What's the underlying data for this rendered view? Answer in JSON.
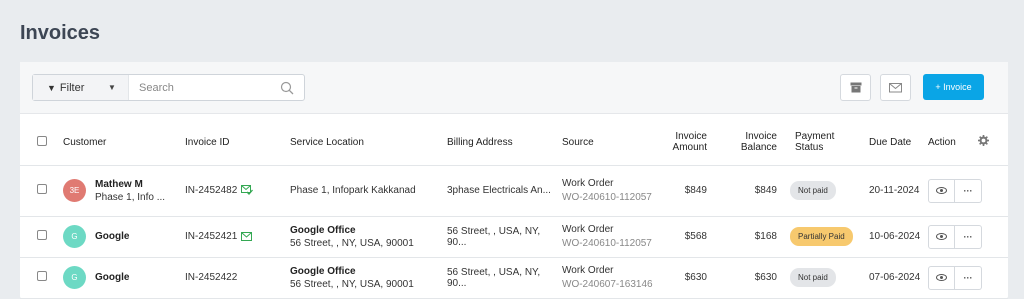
{
  "page": {
    "title": "Invoices"
  },
  "toolbar": {
    "filter_label": "Filter",
    "search_placeholder": "Search",
    "new_invoice_label": "+ Invoice",
    "accent_color": "#0aa5e6"
  },
  "table": {
    "headers": {
      "customer": "Customer",
      "invoice_id": "Invoice ID",
      "service_location": "Service Location",
      "billing_address": "Billing Address",
      "source": "Source",
      "invoice_amount_1": "Invoice",
      "invoice_amount_2": "Amount",
      "invoice_balance_1": "Invoice",
      "invoice_balance_2": "Balance",
      "payment_status": "Payment Status",
      "due_date": "Due Date",
      "action": "Action"
    },
    "rows": [
      {
        "avatar": "3E",
        "avatar_color": "#e07a72",
        "name": "Mathew M",
        "name_sub": "Phase 1, Info ...",
        "invoice_id": "IN-2452482",
        "sent_icon": "mail-check-icon",
        "location_name": "",
        "location_addr": "Phase 1, Infopark Kakkanad",
        "billing": "3phase Electricals An...",
        "source_type": "Work Order",
        "source_id": "WO-240610-112057",
        "amount": "$849",
        "balance": "$849",
        "status": "Not paid",
        "status_color": "#e3e5e8",
        "due": "20-11-2024"
      },
      {
        "avatar": "G",
        "avatar_color": "#6dd9c4",
        "name": "Google",
        "name_sub": "",
        "invoice_id": "IN-2452421",
        "sent_icon": "mail-icon",
        "location_name": "Google Office",
        "location_addr": "56 Street, , NY, USA, 90001",
        "billing": "56 Street, , USA, NY, 90...",
        "source_type": "Work Order",
        "source_id": "WO-240610-112057",
        "amount": "$568",
        "balance": "$168",
        "status": "Partially Paid",
        "status_color": "#f7c96e",
        "due": "10-06-2024"
      },
      {
        "avatar": "G",
        "avatar_color": "#6dd9c4",
        "name": "Google",
        "name_sub": "",
        "invoice_id": "IN-2452422",
        "sent_icon": "",
        "location_name": "Google Office",
        "location_addr": "56 Street, , NY, USA, 90001",
        "billing": "56 Street, , USA, NY, 90...",
        "source_type": "Work Order",
        "source_id": "WO-240607-163146",
        "amount": "$630",
        "balance": "$630",
        "status": "Not paid",
        "status_color": "#e3e5e8",
        "due": "07-06-2024"
      }
    ],
    "row_actions": {
      "view_icon": "eye-icon",
      "more_icon": "ellipsis-icon",
      "more_label": "···"
    }
  }
}
